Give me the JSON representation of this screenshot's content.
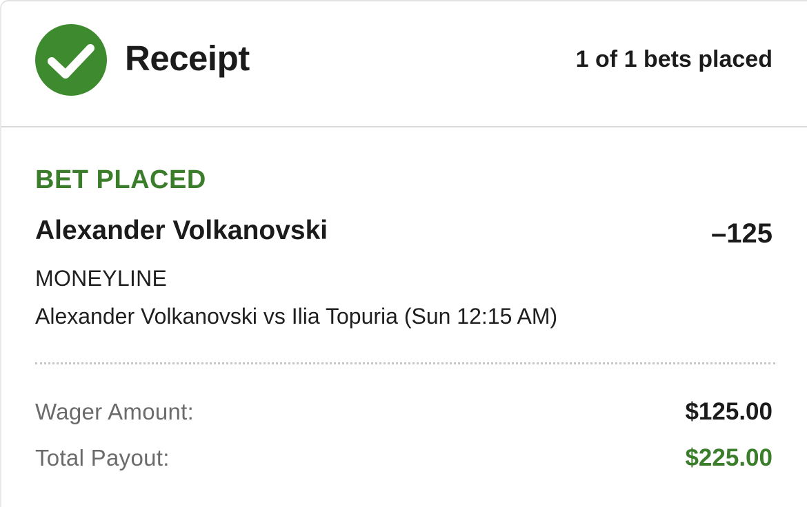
{
  "header": {
    "title": "Receipt",
    "bets_placed": "1 of 1 bets placed",
    "status_icon": "check-circle-icon"
  },
  "bet": {
    "status": "BET PLACED",
    "selection": "Alexander Volkanovski",
    "odds": "–125",
    "market": "MONEYLINE",
    "event": "Alexander Volkanovski vs Ilia Topuria (Sun 12:15 AM)"
  },
  "summary": {
    "wager_label": "Wager Amount:",
    "wager_value": "$125.00",
    "payout_label": "Total Payout:",
    "payout_value": "$225.00"
  },
  "colors": {
    "accent_green": "#3a7d2a",
    "text_dark": "#1b1b1b",
    "text_muted": "#6b6b6b"
  }
}
